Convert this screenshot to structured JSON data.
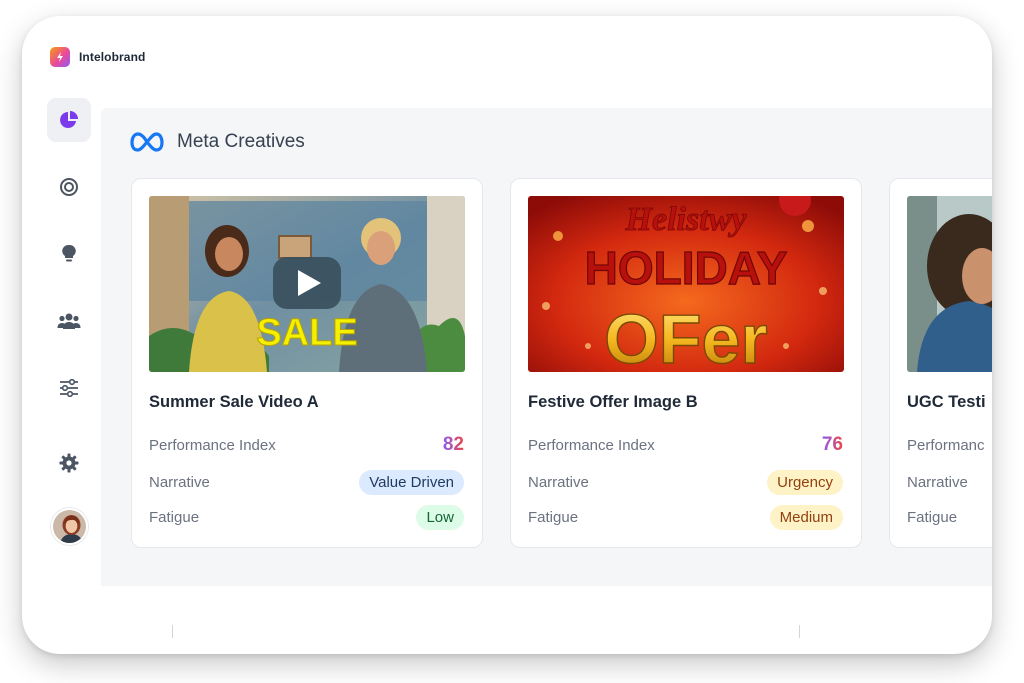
{
  "app": {
    "brand_name": "Intelobrand",
    "brand_colors": [
      "#f59e0b",
      "#ec4899",
      "#8b5cf6"
    ]
  },
  "sidebar": {
    "items": [
      {
        "icon": "pie-chart-icon",
        "active": true,
        "color": "#7c3aed"
      },
      {
        "icon": "target-icon",
        "active": false
      },
      {
        "icon": "lightbulb-icon",
        "active": false
      },
      {
        "icon": "users-icon",
        "active": false
      },
      {
        "icon": "sliders-icon",
        "active": false
      },
      {
        "icon": "gear-icon",
        "active": false
      }
    ],
    "avatar": "user-avatar"
  },
  "section": {
    "icon": "meta-logo-icon",
    "title": "Meta Creatives"
  },
  "cards": [
    {
      "title": "Summer Sale Video A",
      "media_type": "video",
      "thumbnail_text": "SALE",
      "performance_label": "Performance Index",
      "performance_value": "82",
      "narrative_label": "Narrative",
      "narrative_value": "Value Driven",
      "narrative_color": "blue",
      "fatigue_label": "Fatigue",
      "fatigue_value": "Low",
      "fatigue_color": "green"
    },
    {
      "title": "Festive Offer Image B",
      "media_type": "image",
      "thumbnail_line1": "Helistwy",
      "thumbnail_line2": "HOLIDAY",
      "thumbnail_line3": "OFer",
      "performance_label": "Performance Index",
      "performance_value": "76",
      "narrative_label": "Narrative",
      "narrative_value": "Urgency",
      "narrative_color": "yellow",
      "fatigue_label": "Fatigue",
      "fatigue_value": "Medium",
      "fatigue_color": "yellow"
    },
    {
      "title": "UGC Testi",
      "media_type": "image",
      "performance_label": "Performanc",
      "narrative_label": "Narrative",
      "fatigue_label": "Fatigue"
    }
  ],
  "colors": {
    "accent_purple": "#7c3aed",
    "meta_blue": "#1877f2",
    "score_gradient": [
      "#8b5cf6",
      "#ef4444"
    ]
  }
}
